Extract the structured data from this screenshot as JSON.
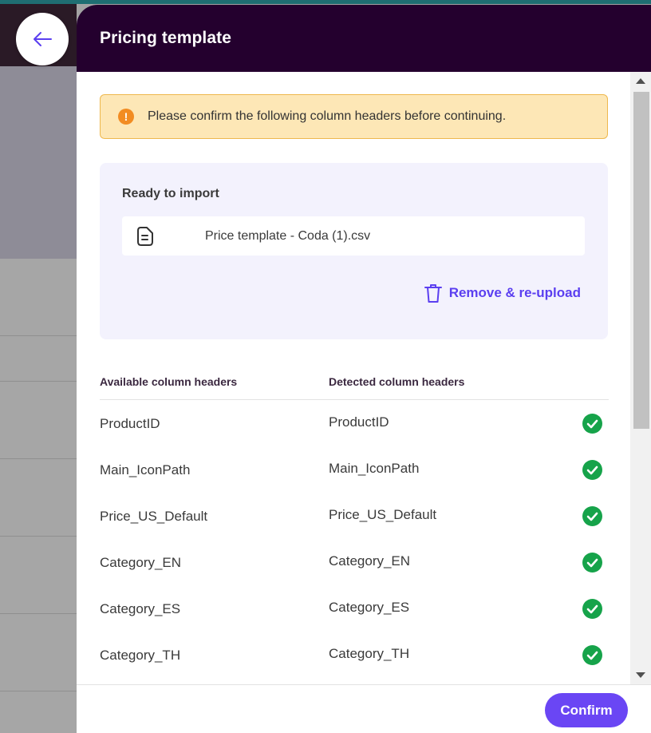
{
  "colors": {
    "header_bg": "#24002e",
    "accent": "#5b3ff0",
    "confirm_bg": "#6a46f4",
    "alert_bg": "#fde7b6",
    "alert_icon": "#f28c22",
    "success": "#16a34a"
  },
  "nav": {
    "back_icon": "arrow-left-icon"
  },
  "panel": {
    "title": "Pricing template"
  },
  "alert": {
    "icon": "exclamation-icon",
    "text": "Please confirm the following column headers before continuing."
  },
  "import": {
    "title": "Ready to import",
    "file_icon": "file-icon",
    "file_name": "Price template - Coda (1).csv",
    "remove_icon": "trash-icon",
    "remove_label": "Remove & re-upload"
  },
  "table": {
    "headers": {
      "available": "Available column headers",
      "detected": "Detected column headers"
    },
    "rows": [
      {
        "available": "ProductID",
        "detected": "ProductID",
        "status": "check-icon"
      },
      {
        "available": "Main_IconPath",
        "detected": "Main_IconPath",
        "status": "check-icon"
      },
      {
        "available": "Price_US_Default",
        "detected": "Price_US_Default",
        "status": "check-icon"
      },
      {
        "available": "Category_EN",
        "detected": "Category_EN",
        "status": "check-icon"
      },
      {
        "available": "Category_ES",
        "detected": "Category_ES",
        "status": "check-icon"
      },
      {
        "available": "Category_TH",
        "detected": "Category_TH",
        "status": "check-icon"
      }
    ]
  },
  "footer": {
    "confirm_label": "Confirm"
  }
}
